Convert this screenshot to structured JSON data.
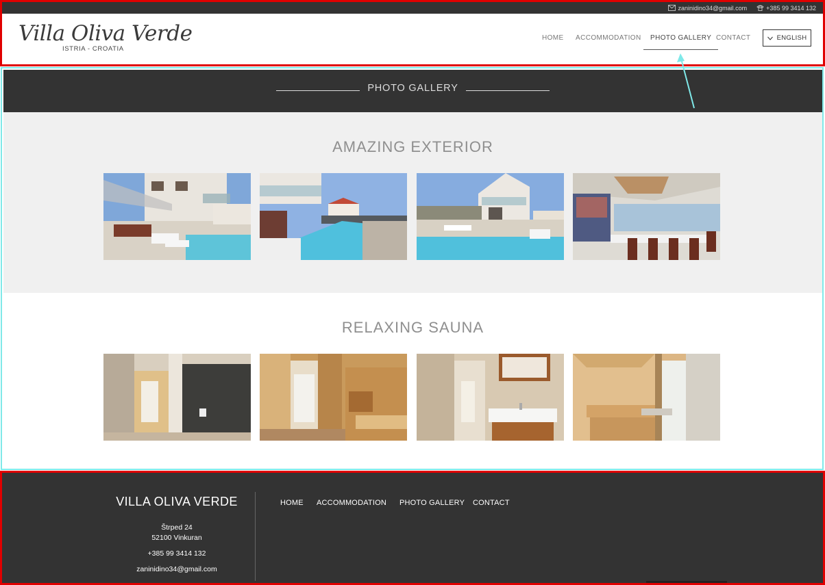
{
  "topbar": {
    "email": "zaninidino34@gmail.com",
    "phone": "+385 99 3414 132",
    "email_icon": "mail-icon",
    "phone_icon": "phone-icon"
  },
  "logo": {
    "name": "Villa Oliva Verde",
    "tagline": "ISTRIA - CROATIA"
  },
  "nav": {
    "items": [
      {
        "label": "HOME",
        "active": false
      },
      {
        "label": "ACCOMMODATION",
        "active": false
      },
      {
        "label": "PHOTO GALLERY",
        "active": true
      },
      {
        "label": "CONTACT",
        "active": false
      }
    ],
    "language": "ENGLISH"
  },
  "banner": {
    "title": "PHOTO GALLERY"
  },
  "sections": [
    {
      "title": "AMAZING EXTERIOR",
      "photos": [
        "pool-terrace-photo",
        "pool-side-photo",
        "pool-house-photo",
        "dining-terrace-photo"
      ]
    },
    {
      "title": "RELAXING SAUNA",
      "photos": [
        "shower-room-photo",
        "sauna-door-photo",
        "bathroom-sink-photo",
        "sauna-bench-photo"
      ]
    }
  ],
  "footer": {
    "brand": "VILLA OLIVA VERDE",
    "address_line1": "Štrped 24",
    "address_line2": "52100 Vinkuran",
    "phone": "+385 99 3414 132",
    "email": "zaninidino34@gmail.com",
    "menu": [
      "HOME",
      "ACCOMMODATION",
      "PHOTO GALLERY",
      "CONTACT"
    ]
  },
  "colors": {
    "dark": "#333333",
    "annotation_red": "#e00000",
    "annotation_cyan": "#7fe9e9",
    "section_grey": "#f0f0f0"
  }
}
